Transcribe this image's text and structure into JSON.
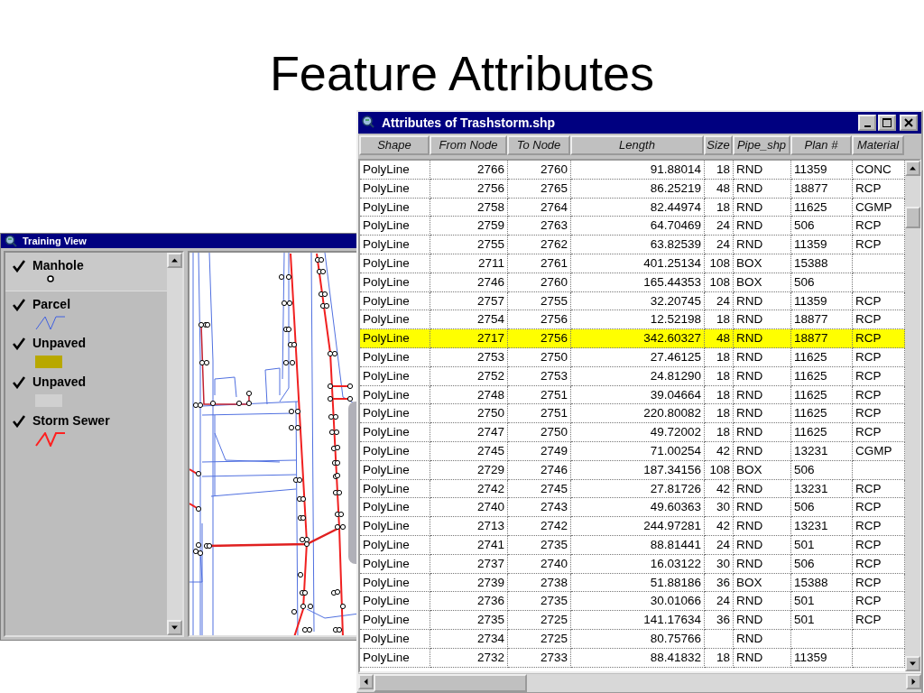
{
  "slide_title": "Feature Attributes",
  "training_view": {
    "title": "Training View",
    "legend": [
      {
        "label": "Manhole",
        "checked": true,
        "selected": true,
        "kind": "point"
      },
      {
        "label": "Parcel",
        "checked": true,
        "selected": false,
        "kind": "line",
        "color": "#4060e0"
      },
      {
        "label": "Unpaved",
        "checked": true,
        "selected": false,
        "kind": "fill",
        "color": "#b8a800"
      },
      {
        "label": "Unpaved",
        "checked": true,
        "selected": false,
        "kind": "fill",
        "color": "#d0d0d0"
      },
      {
        "label": "Storm Sewer",
        "checked": true,
        "selected": false,
        "kind": "line",
        "color": "#ff2020"
      }
    ]
  },
  "attributes_window": {
    "title": "Attributes of Trashstorm.shp",
    "columns": [
      "Shape",
      "From Node",
      "To Node",
      "Length",
      "Size",
      "Pipe_shp",
      "Plan #",
      "Material"
    ],
    "rows": [
      {
        "selected": false,
        "cells": [
          "PolyLine",
          "2766",
          "2760",
          "91.88014",
          "18",
          "RND",
          "11359",
          "CONC"
        ]
      },
      {
        "selected": false,
        "cells": [
          "PolyLine",
          "2756",
          "2765",
          "86.25219",
          "48",
          "RND",
          "18877",
          "RCP"
        ]
      },
      {
        "selected": false,
        "cells": [
          "PolyLine",
          "2758",
          "2764",
          "82.44974",
          "18",
          "RND",
          "11625",
          "CGMP"
        ]
      },
      {
        "selected": false,
        "cells": [
          "PolyLine",
          "2759",
          "2763",
          "64.70469",
          "24",
          "RND",
          "506",
          "RCP"
        ]
      },
      {
        "selected": false,
        "cells": [
          "PolyLine",
          "2755",
          "2762",
          "63.82539",
          "24",
          "RND",
          "11359",
          "RCP"
        ]
      },
      {
        "selected": false,
        "cells": [
          "PolyLine",
          "2711",
          "2761",
          "401.25134",
          "108",
          "BOX",
          "15388",
          null
        ]
      },
      {
        "selected": false,
        "cells": [
          "PolyLine",
          "2746",
          "2760",
          "165.44353",
          "108",
          "BOX",
          "506",
          null
        ]
      },
      {
        "selected": false,
        "cells": [
          "PolyLine",
          "2757",
          "2755",
          "32.20745",
          "24",
          "RND",
          "11359",
          "RCP"
        ]
      },
      {
        "selected": false,
        "cells": [
          "PolyLine",
          "2754",
          "2756",
          "12.52198",
          "18",
          "RND",
          "18877",
          "RCP"
        ]
      },
      {
        "selected": true,
        "cells": [
          "PolyLine",
          "2717",
          "2756",
          "342.60327",
          "48",
          "RND",
          "18877",
          "RCP"
        ]
      },
      {
        "selected": false,
        "cells": [
          "PolyLine",
          "2753",
          "2750",
          "27.46125",
          "18",
          "RND",
          "11625",
          "RCP"
        ]
      },
      {
        "selected": false,
        "cells": [
          "PolyLine",
          "2752",
          "2753",
          "24.81290",
          "18",
          "RND",
          "11625",
          "RCP"
        ]
      },
      {
        "selected": false,
        "cells": [
          "PolyLine",
          "2748",
          "2751",
          "39.04664",
          "18",
          "RND",
          "11625",
          "RCP"
        ]
      },
      {
        "selected": false,
        "cells": [
          "PolyLine",
          "2750",
          "2751",
          "220.80082",
          "18",
          "RND",
          "11625",
          "RCP"
        ]
      },
      {
        "selected": false,
        "cells": [
          "PolyLine",
          "2747",
          "2750",
          "49.72002",
          "18",
          "RND",
          "11625",
          "RCP"
        ]
      },
      {
        "selected": false,
        "cells": [
          "PolyLine",
          "2745",
          "2749",
          "71.00254",
          "42",
          "RND",
          "13231",
          "CGMP"
        ]
      },
      {
        "selected": false,
        "cells": [
          "PolyLine",
          "2729",
          "2746",
          "187.34156",
          "108",
          "BOX",
          "506",
          null
        ]
      },
      {
        "selected": false,
        "cells": [
          "PolyLine",
          "2742",
          "2745",
          "27.81726",
          "42",
          "RND",
          "13231",
          "RCP"
        ]
      },
      {
        "selected": false,
        "cells": [
          "PolyLine",
          "2740",
          "2743",
          "49.60363",
          "30",
          "RND",
          "506",
          "RCP"
        ]
      },
      {
        "selected": false,
        "cells": [
          "PolyLine",
          "2713",
          "2742",
          "244.97281",
          "42",
          "RND",
          "13231",
          "RCP"
        ]
      },
      {
        "selected": false,
        "cells": [
          "PolyLine",
          "2741",
          "2735",
          "88.81441",
          "24",
          "RND",
          "501",
          "RCP"
        ]
      },
      {
        "selected": false,
        "cells": [
          "PolyLine",
          "2737",
          "2740",
          "16.03122",
          "30",
          "RND",
          "506",
          "RCP"
        ]
      },
      {
        "selected": false,
        "cells": [
          "PolyLine",
          "2739",
          "2738",
          "51.88186",
          "36",
          "BOX",
          "15388",
          "RCP"
        ]
      },
      {
        "selected": false,
        "cells": [
          "PolyLine",
          "2736",
          "2735",
          "30.01066",
          "24",
          "RND",
          "501",
          "RCP"
        ]
      },
      {
        "selected": false,
        "cells": [
          "PolyLine",
          "2735",
          "2725",
          "141.17634",
          "36",
          "RND",
          "501",
          "RCP"
        ]
      },
      {
        "selected": false,
        "cells": [
          "PolyLine",
          "2734",
          "2725",
          "80.75766",
          null,
          "RND",
          null,
          null
        ]
      },
      {
        "selected": false,
        "cells": [
          "PolyLine",
          "2732",
          "2733",
          "88.41832",
          "18",
          "RND",
          "11359",
          null
        ]
      }
    ]
  }
}
